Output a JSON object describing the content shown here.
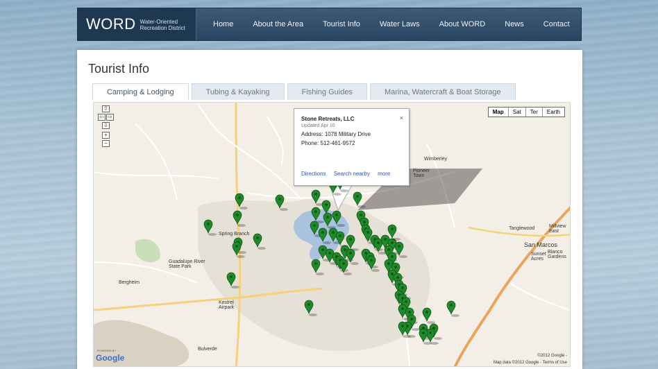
{
  "header": {
    "logo_word": "WORD",
    "logo_tag_line1": "Water-Oriented",
    "logo_tag_line2": "Recreation District",
    "nav": [
      "Home",
      "About the Area",
      "Tourist Info",
      "Water Laws",
      "About WORD",
      "News",
      "Contact"
    ]
  },
  "page": {
    "title": "Tourist Info",
    "tabs": [
      "Camping & Lodging",
      "Tubing & Kayaking",
      "Fishing Guides",
      "Marina, Watercraft & Boat Storage"
    ],
    "active_tab": "Camping & Lodging"
  },
  "map": {
    "map_types": [
      "Map",
      "Sat",
      "Ter",
      "Earth"
    ],
    "active_type": "Map",
    "zoom_controls": [
      "⇧",
      "⇦",
      "⇨",
      "⇩",
      "+",
      "−"
    ],
    "infowindow": {
      "title": "Stone Retreats, LLC",
      "updated": "Updated Apr 10",
      "address_label": "Address:",
      "address": "1078 Military Drive",
      "phone_label": "Phone:",
      "phone": "512-461-9572",
      "links": [
        "Directions",
        "Search nearby",
        "more"
      ],
      "close": "×"
    },
    "labels": {
      "spring_branch": "Spring Branch",
      "guadalupe": "Guadalupe River State Park",
      "bergheim": "Bergheim",
      "kestrel": "Kestrel Airpark",
      "wimberley": "Wimberley",
      "pioneer": "Pioneer Town",
      "tanglewood": "Tanglewood",
      "millview": "Millview East",
      "san_marcos": "San Marcos",
      "sunset_acres": "Sunset Acres",
      "blanco_gardens": "Blanco Gardens",
      "bulverde": "Bulverde"
    },
    "google_powered": "POWERED BY",
    "google": "Google",
    "copyright": "Map data ©2012 Google - Terms of Use",
    "copyright2": "©2012 Google -",
    "marker_color": "#1f8a2a",
    "lake_color": "#a9c3de"
  }
}
